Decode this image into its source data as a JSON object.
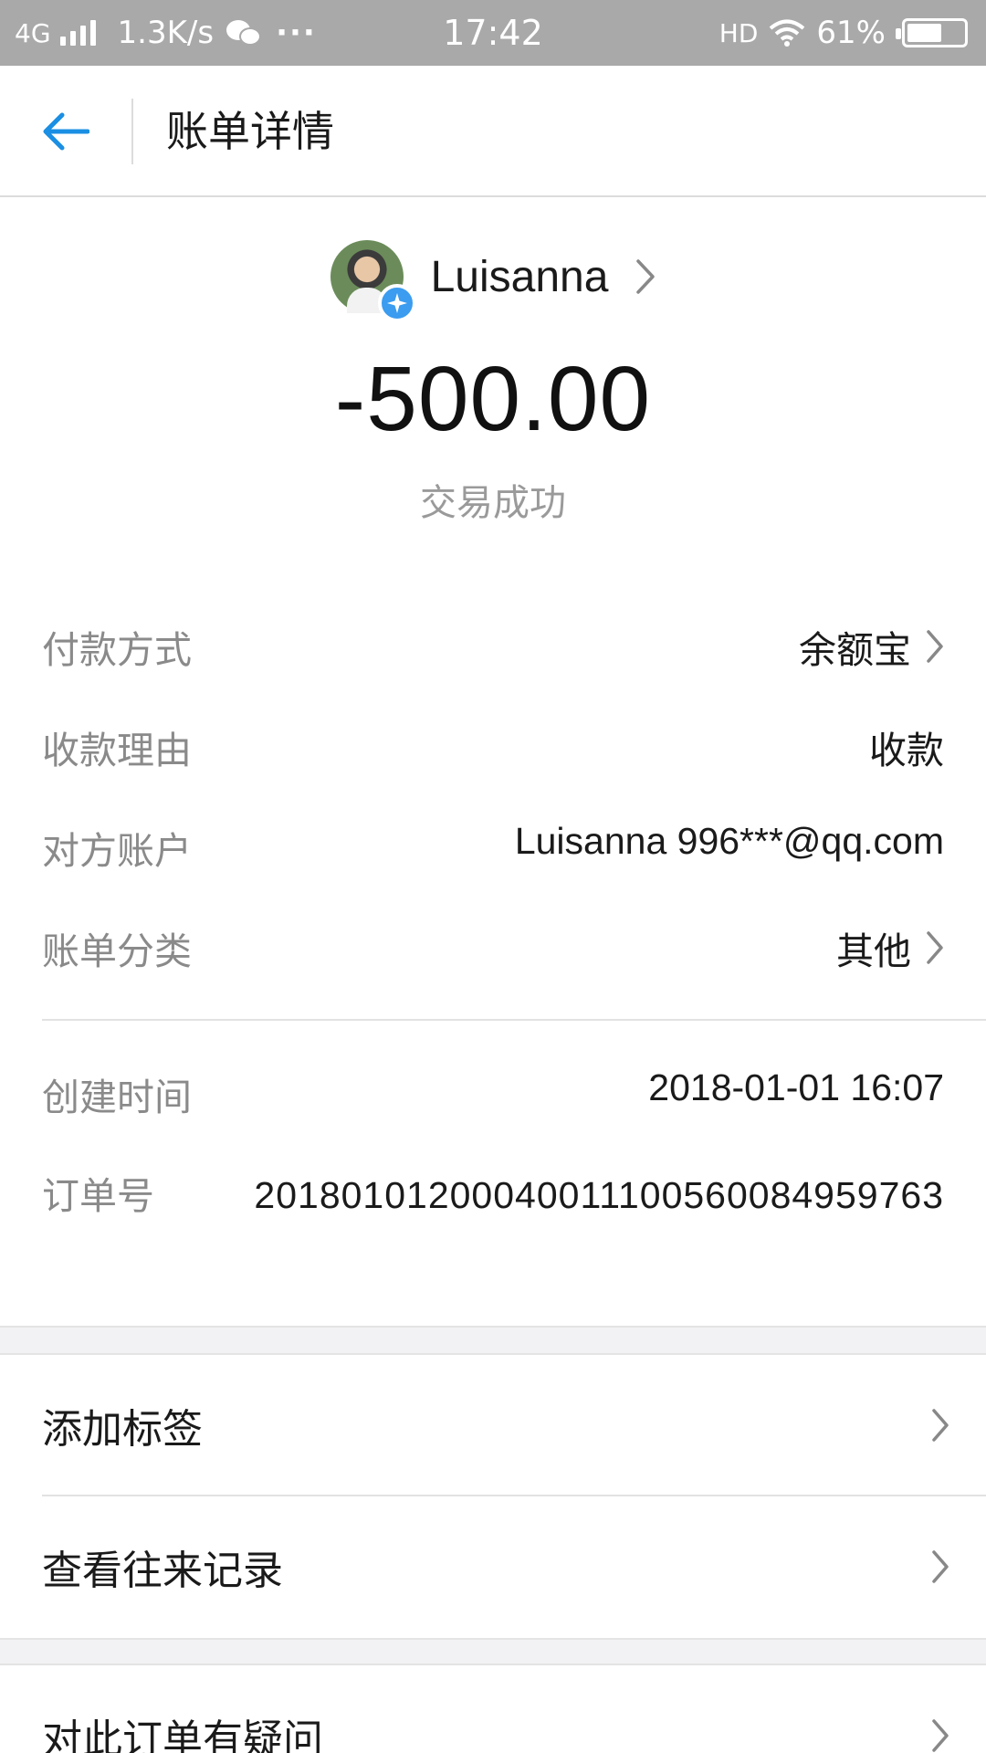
{
  "status_bar": {
    "network": "4G",
    "speed": "1.3K/s",
    "more": "···",
    "time": "17:42",
    "hd": "HD",
    "battery": "61%",
    "battery_level": 0.61
  },
  "nav": {
    "title": "账单详情"
  },
  "header": {
    "payee_name": "Luisanna",
    "amount": "-500.00",
    "status": "交易成功"
  },
  "details": [
    {
      "label": "付款方式",
      "value": "余额宝"
    },
    {
      "label": "收款理由",
      "value": "收款"
    },
    {
      "label": "对方账户",
      "value": "Luisanna 996***@qq.com"
    },
    {
      "label": "账单分类",
      "value": "其他"
    }
  ],
  "meta": [
    {
      "label": "创建时间",
      "value": "2018-01-01 16:07"
    },
    {
      "label": "订单号",
      "value": "20180101200040011100560084959763"
    }
  ],
  "menu": [
    {
      "label": "添加标签"
    },
    {
      "label": "查看往来记录"
    },
    {
      "label": "对此订单有疑问"
    }
  ],
  "colors": {
    "status_bar_bg": "#a9a9a9",
    "accent_blue": "#1a8fe3",
    "label_gray": "#8a8a8a",
    "band_bg": "#f2f2f4"
  }
}
